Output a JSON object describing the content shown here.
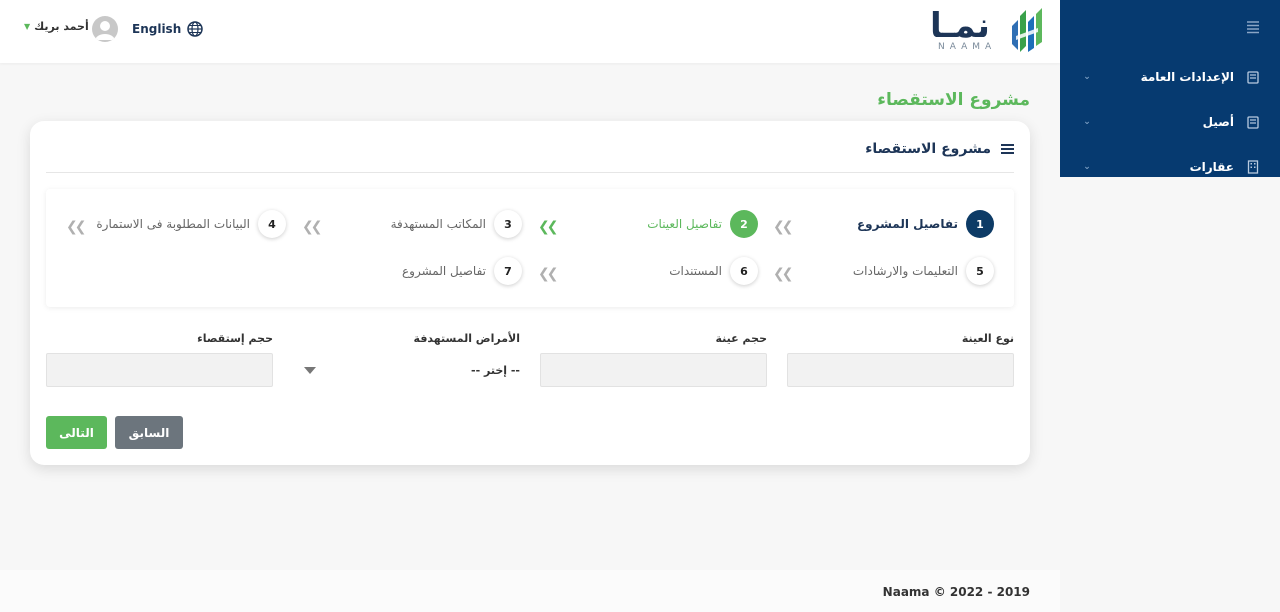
{
  "header": {
    "logo_text": "نمـا",
    "logo_subtext": "NAAMA",
    "language_label": "English",
    "user_name": "أحمد بريك"
  },
  "sidebar": {
    "items": [
      {
        "label": "الإعدادات العامة",
        "icon": "book-icon"
      },
      {
        "label": "أصيل",
        "icon": "book-icon"
      },
      {
        "label": "عقارات",
        "icon": "building-icon"
      }
    ]
  },
  "page": {
    "title": "مشروع الاستقصاء",
    "card_title": "مشروع الاستقصاء"
  },
  "steps": [
    {
      "number": "1",
      "label": "تفاصيل المشروع",
      "state": "done"
    },
    {
      "number": "2",
      "label": "تفاصيل العينات",
      "state": "active"
    },
    {
      "number": "3",
      "label": "المكاتب المستهدفة",
      "state": "pending"
    },
    {
      "number": "4",
      "label": "البيانات المطلوبة فى الاستمارة",
      "state": "pending"
    },
    {
      "number": "5",
      "label": "التعليمات والارشادات",
      "state": "pending"
    },
    {
      "number": "6",
      "label": "المستندات",
      "state": "pending"
    },
    {
      "number": "7",
      "label": "تفاصيل المشروع",
      "state": "pending"
    }
  ],
  "form": {
    "sample_type_label": "نوع العينة",
    "sample_size_label": "حجم عينة",
    "diseases_label": "الأمراض المستهدفة",
    "diseases_selected": "-- إختر --",
    "survey_size_label": "حجم إستقصاء"
  },
  "buttons": {
    "prev": "السابق",
    "next": "التالى"
  },
  "footer": {
    "text": "Naama © 2022 - 2019"
  },
  "colors": {
    "primary_navy": "#063a70",
    "accent_green": "#5cb85c",
    "secondary_gray": "#6c757d"
  }
}
